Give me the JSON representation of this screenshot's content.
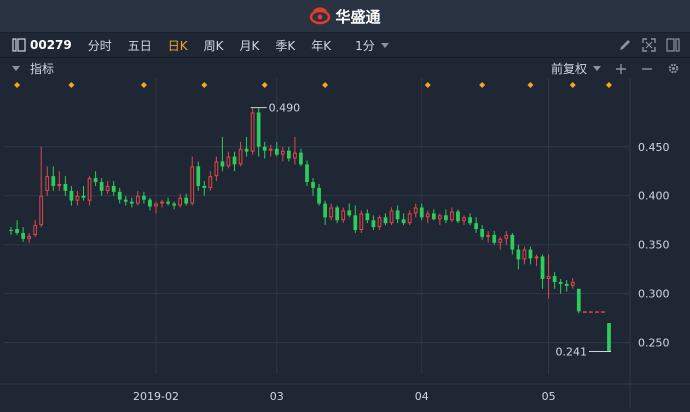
{
  "brand": {
    "name": "华盛通",
    "logo_color": "#e63a2e"
  },
  "toolbar": {
    "code": "00279",
    "periods": [
      {
        "label": "分时",
        "active": false
      },
      {
        "label": "五日",
        "active": false
      },
      {
        "label": "日K",
        "active": true
      },
      {
        "label": "周K",
        "active": false
      },
      {
        "label": "月K",
        "active": false
      },
      {
        "label": "季K",
        "active": false
      },
      {
        "label": "年K",
        "active": false
      }
    ],
    "minute_label": "1分",
    "icons": [
      "pen-icon",
      "expand-icon",
      "layout-icon"
    ]
  },
  "indicator_bar": {
    "label": "指标",
    "adjust_label": "前复权",
    "icons": [
      "plus-icon",
      "minus-icon",
      "settings-icon"
    ]
  },
  "colors": {
    "up": "#e04848",
    "down": "#2ecc5a",
    "marker": "#f5a623",
    "grid": "#2e3848",
    "text": "#cfd6e0"
  },
  "chart_data": {
    "type": "candlestick",
    "yticks": [
      0.25,
      0.3,
      0.35,
      0.4,
      0.45
    ],
    "ytick_labels": [
      "0.250",
      "0.300",
      "0.350",
      "0.400",
      "0.450"
    ],
    "ylim": [
      0.218,
      0.51
    ],
    "xtick_labels": [
      {
        "label": "2019-02",
        "index": 24
      },
      {
        "label": "03",
        "index": 44
      },
      {
        "label": "04",
        "index": 68
      },
      {
        "label": "05",
        "index": 89
      }
    ],
    "annotations": [
      {
        "label": "0.490",
        "index": 40,
        "value": 0.49
      },
      {
        "label": "0.241",
        "index": 99,
        "value": 0.241
      }
    ],
    "marker_indices": [
      1,
      10,
      22,
      32,
      42,
      52,
      69,
      78,
      86,
      93,
      99
    ],
    "candles": [
      [
        0.365,
        0.368,
        0.36,
        0.364
      ],
      [
        0.366,
        0.375,
        0.36,
        0.362
      ],
      [
        0.362,
        0.368,
        0.353,
        0.356
      ],
      [
        0.356,
        0.362,
        0.352,
        0.359
      ],
      [
        0.36,
        0.375,
        0.358,
        0.37
      ],
      [
        0.37,
        0.45,
        0.368,
        0.4
      ],
      [
        0.405,
        0.43,
        0.4,
        0.42
      ],
      [
        0.42,
        0.43,
        0.405,
        0.41
      ],
      [
        0.41,
        0.425,
        0.405,
        0.412
      ],
      [
        0.412,
        0.42,
        0.4,
        0.405
      ],
      [
        0.405,
        0.41,
        0.39,
        0.395
      ],
      [
        0.395,
        0.405,
        0.39,
        0.4
      ],
      [
        0.4,
        0.41,
        0.395,
        0.398
      ],
      [
        0.395,
        0.42,
        0.39,
        0.418
      ],
      [
        0.418,
        0.425,
        0.41,
        0.414
      ],
      [
        0.414,
        0.418,
        0.4,
        0.405
      ],
      [
        0.405,
        0.415,
        0.402,
        0.41
      ],
      [
        0.41,
        0.415,
        0.4,
        0.404
      ],
      [
        0.404,
        0.408,
        0.392,
        0.396
      ],
      [
        0.396,
        0.4,
        0.39,
        0.394
      ],
      [
        0.394,
        0.398,
        0.388,
        0.392
      ],
      [
        0.392,
        0.405,
        0.39,
        0.4
      ],
      [
        0.4,
        0.404,
        0.392,
        0.396
      ],
      [
        0.396,
        0.398,
        0.385,
        0.389
      ],
      [
        0.389,
        0.394,
        0.382,
        0.392
      ],
      [
        0.392,
        0.396,
        0.388,
        0.394
      ],
      [
        0.394,
        0.398,
        0.39,
        0.392
      ],
      [
        0.392,
        0.394,
        0.386,
        0.39
      ],
      [
        0.39,
        0.402,
        0.388,
        0.398
      ],
      [
        0.398,
        0.402,
        0.39,
        0.392
      ],
      [
        0.392,
        0.44,
        0.39,
        0.43
      ],
      [
        0.43,
        0.435,
        0.405,
        0.41
      ],
      [
        0.41,
        0.415,
        0.4,
        0.408
      ],
      [
        0.408,
        0.425,
        0.405,
        0.42
      ],
      [
        0.42,
        0.44,
        0.415,
        0.435
      ],
      [
        0.435,
        0.46,
        0.425,
        0.43
      ],
      [
        0.43,
        0.445,
        0.428,
        0.44
      ],
      [
        0.44,
        0.445,
        0.425,
        0.432
      ],
      [
        0.432,
        0.455,
        0.43,
        0.448
      ],
      [
        0.448,
        0.46,
        0.44,
        0.445
      ],
      [
        0.445,
        0.49,
        0.442,
        0.485
      ],
      [
        0.485,
        0.49,
        0.44,
        0.45
      ],
      [
        0.45,
        0.455,
        0.438,
        0.446
      ],
      [
        0.446,
        0.452,
        0.44,
        0.448
      ],
      [
        0.448,
        0.455,
        0.44,
        0.442
      ],
      [
        0.442,
        0.45,
        0.435,
        0.446
      ],
      [
        0.446,
        0.45,
        0.435,
        0.438
      ],
      [
        0.438,
        0.46,
        0.432,
        0.444
      ],
      [
        0.444,
        0.448,
        0.43,
        0.432
      ],
      [
        0.432,
        0.436,
        0.41,
        0.414
      ],
      [
        0.414,
        0.418,
        0.4,
        0.408
      ],
      [
        0.408,
        0.412,
        0.39,
        0.392
      ],
      [
        0.392,
        0.395,
        0.37,
        0.378
      ],
      [
        0.378,
        0.392,
        0.375,
        0.388
      ],
      [
        0.388,
        0.39,
        0.372,
        0.375
      ],
      [
        0.375,
        0.388,
        0.372,
        0.385
      ],
      [
        0.385,
        0.392,
        0.378,
        0.38
      ],
      [
        0.38,
        0.39,
        0.362,
        0.365
      ],
      [
        0.365,
        0.385,
        0.362,
        0.382
      ],
      [
        0.382,
        0.386,
        0.372,
        0.375
      ],
      [
        0.375,
        0.38,
        0.365,
        0.368
      ],
      [
        0.368,
        0.38,
        0.365,
        0.378
      ],
      [
        0.378,
        0.382,
        0.37,
        0.372
      ],
      [
        0.372,
        0.388,
        0.37,
        0.385
      ],
      [
        0.385,
        0.39,
        0.372,
        0.376
      ],
      [
        0.376,
        0.382,
        0.37,
        0.372
      ],
      [
        0.372,
        0.385,
        0.37,
        0.382
      ],
      [
        0.382,
        0.392,
        0.378,
        0.388
      ],
      [
        0.388,
        0.392,
        0.375,
        0.378
      ],
      [
        0.378,
        0.385,
        0.372,
        0.382
      ],
      [
        0.382,
        0.386,
        0.375,
        0.376
      ],
      [
        0.376,
        0.382,
        0.37,
        0.38
      ],
      [
        0.38,
        0.386,
        0.372,
        0.375
      ],
      [
        0.375,
        0.388,
        0.373,
        0.384
      ],
      [
        0.384,
        0.386,
        0.372,
        0.374
      ],
      [
        0.374,
        0.38,
        0.37,
        0.378
      ],
      [
        0.378,
        0.382,
        0.37,
        0.372
      ],
      [
        0.372,
        0.378,
        0.362,
        0.366
      ],
      [
        0.366,
        0.37,
        0.355,
        0.358
      ],
      [
        0.358,
        0.364,
        0.352,
        0.36
      ],
      [
        0.36,
        0.364,
        0.35,
        0.352
      ],
      [
        0.352,
        0.358,
        0.345,
        0.356
      ],
      [
        0.356,
        0.364,
        0.35,
        0.36
      ],
      [
        0.36,
        0.362,
        0.34,
        0.345
      ],
      [
        0.345,
        0.35,
        0.325,
        0.335
      ],
      [
        0.335,
        0.348,
        0.33,
        0.345
      ],
      [
        0.345,
        0.348,
        0.33,
        0.336
      ],
      [
        0.336,
        0.34,
        0.328,
        0.338
      ],
      [
        0.338,
        0.34,
        0.305,
        0.315
      ],
      [
        0.315,
        0.34,
        0.295,
        0.318
      ],
      [
        0.318,
        0.322,
        0.305,
        0.312
      ],
      [
        0.312,
        0.315,
        0.3,
        0.31
      ],
      [
        0.31,
        0.314,
        0.302,
        0.308
      ],
      [
        0.308,
        0.316,
        0.305,
        0.312
      ],
      [
        0.305,
        0.305,
        0.28,
        0.282
      ],
      [
        0.282,
        0.282,
        0.282,
        0.282
      ],
      [
        0.282,
        0.282,
        0.282,
        0.282
      ],
      [
        0.282,
        0.282,
        0.282,
        0.282
      ],
      [
        0.282,
        0.282,
        0.282,
        0.282
      ],
      [
        0.27,
        0.27,
        0.241,
        0.241
      ]
    ]
  }
}
